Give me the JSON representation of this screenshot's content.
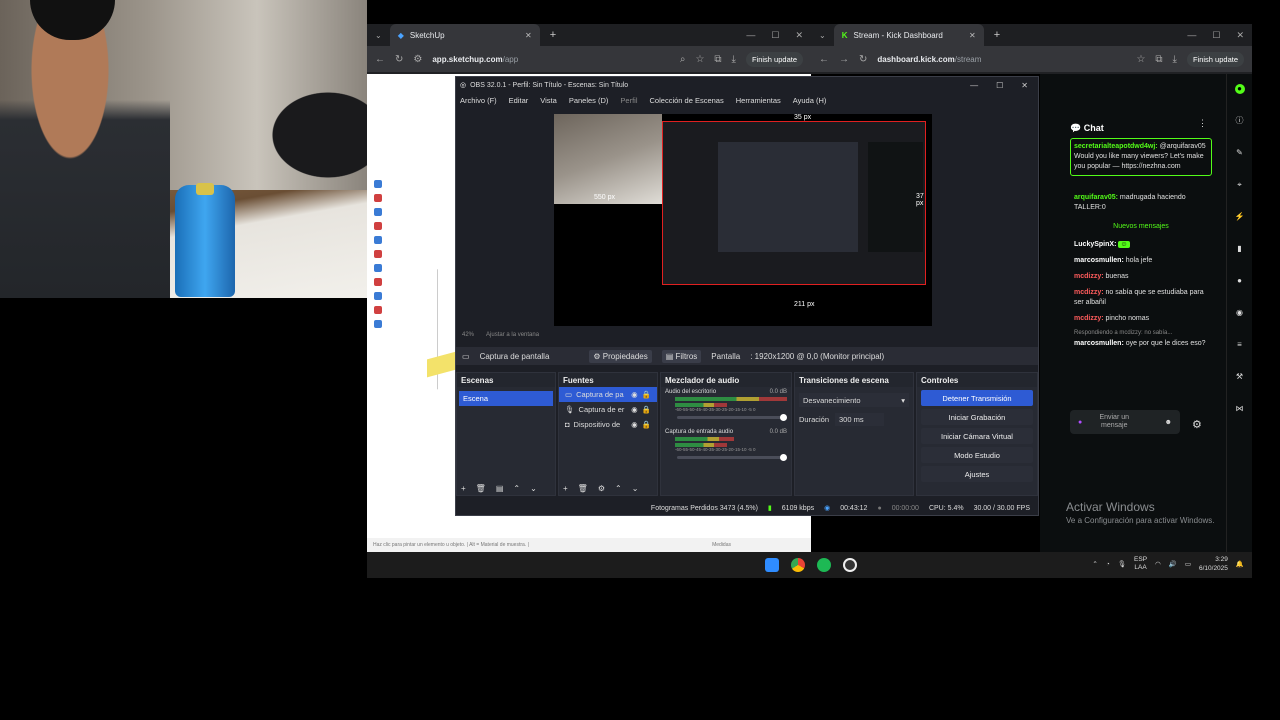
{
  "browser_left": {
    "tab_title": "SketchUp",
    "url_host": "app.sketchup.com",
    "url_path": "/app",
    "finish_update": "Finish update",
    "sketch_status": "Haz clic para pintar un elemento u objeto. | Alt = Material de muestra. |",
    "sketch_status_right": "Medidas"
  },
  "browser_right": {
    "tab_title": "Stream - Kick Dashboard",
    "url_host": "dashboard.kick.com",
    "url_path": "/stream",
    "finish_update": "Finish update"
  },
  "obs": {
    "title": "OBS 32.0.1 - Perfil: Sin Título - Escenas: Sin Título",
    "menu": [
      "Archivo (F)",
      "Editar",
      "Vista",
      "Paneles (D)",
      "Perfil",
      "Colección de Escenas",
      "Herramientas",
      "Ayuda (H)"
    ],
    "zoom": "42%",
    "fit": "Ajustar a la ventana",
    "px_top": "35 px",
    "px_right": "37 px",
    "px_bottom": "211 px",
    "px_left": "550 px",
    "source_selected": "Captura de pantalla",
    "properties": "Propiedades",
    "filters": "Filtros",
    "display_label": "Pantalla",
    "display_value": ": 1920x1200 @ 0,0 (Monitor principal)",
    "docks": {
      "scenes_title": "Escenas",
      "scene": "Escena",
      "sources_title": "Fuentes",
      "sources": [
        "Captura de pa",
        "Captura de er",
        "Dispositivo de"
      ],
      "mixer_title": "Mezclador de audio",
      "mixer": [
        {
          "name": "Audio del escritorio",
          "db": "0.0 dB"
        },
        {
          "name": "Captura de entrada audio",
          "db": "0.0 dB"
        }
      ],
      "meter_scale": "-60-55-50-45-40-35-30-25-20-15-10 -5  0",
      "transitions_title": "Transiciones de escena",
      "transition": "Desvanecimiento",
      "duration_label": "Duración",
      "duration_value": "300 ms",
      "controls_title": "Controles",
      "controls": [
        "Detener Transmisión",
        "Iniciar Grabación",
        "Iniciar Cámara Virtual",
        "Modo Estudio",
        "Ajustes"
      ]
    },
    "status": {
      "dropped": "Fotogramas Perdidos 3473 (4.5%)",
      "bitrate": "6109 kbps",
      "stream_time": "00:43:12",
      "rec_time": "00:00:00",
      "cpu": "CPU: 5.4%",
      "fps": "30.00 / 30.00 FPS"
    }
  },
  "kick": {
    "chat_title": "Chat",
    "messages": [
      {
        "user": "secretarialteapotdwd4wj:",
        "text": "@arquifarav05 Would you like many viewers? Let's make you popular — https://nezhna.com",
        "color": "green"
      },
      {
        "user": "arquifarav05:",
        "text": "madrugada haciendo TALLER:0",
        "color": "green"
      }
    ],
    "new_messages": "Nuevos mensajes",
    "messages_after": [
      {
        "user": "LuckySpinX:",
        "text": "",
        "color": "white"
      },
      {
        "user": "marcosmullen:",
        "text": "hola jefe",
        "color": "white"
      },
      {
        "user": "mcdizzy:",
        "text": "buenas",
        "color": "red"
      },
      {
        "user": "mcdizzy:",
        "text": "no sabía que se estudiaba para ser albañil",
        "color": "red"
      },
      {
        "user": "mcdizzy:",
        "text": "pincho nomas",
        "color": "red"
      },
      {
        "user": "",
        "text": "Respondiendo a mcdizzy: no sabía...",
        "color": "gray"
      },
      {
        "user": "marcosmullen:",
        "text": "oye por que le dices eso?",
        "color": "white"
      }
    ],
    "send_placeholder": "Enviar un mensaje",
    "activate_title": "Activar Windows",
    "activate_sub": "Ve a Configuración para activar Windows."
  },
  "taskbar": {
    "lang1": "ESP",
    "lang2": "LAA",
    "time": "3:29",
    "date": "6/10/2025"
  },
  "colors": {
    "kick_green": "#53fc18",
    "obs_blue": "#2e5bd4",
    "selection_red": "#e02020"
  }
}
